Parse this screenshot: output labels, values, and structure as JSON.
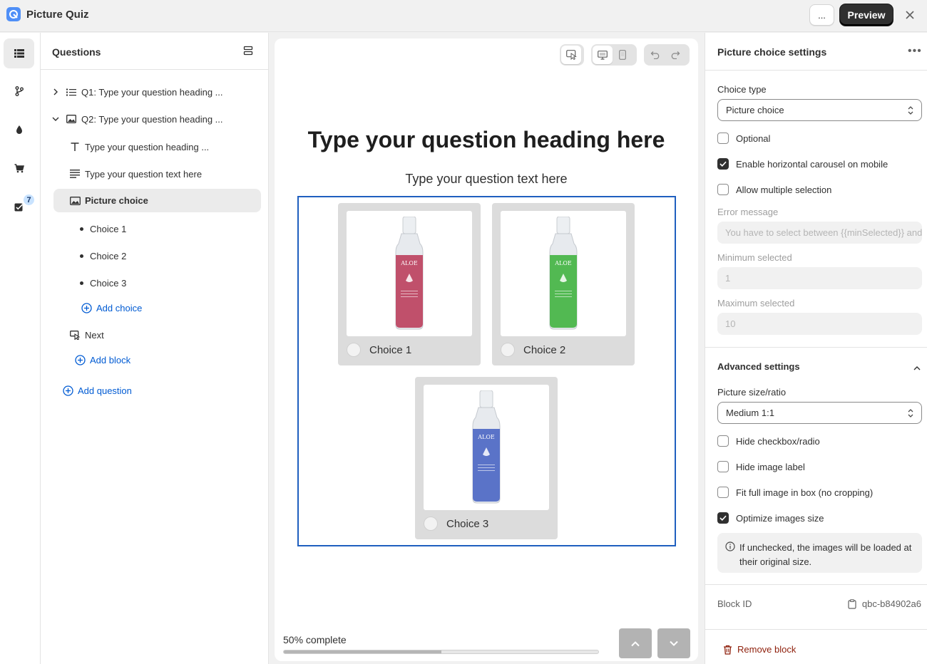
{
  "app": {
    "title": "Picture Quiz"
  },
  "topbar": {
    "more_label": "...",
    "preview_label": "Preview"
  },
  "rail": {
    "badge_count": "7"
  },
  "questions_panel": {
    "title": "Questions",
    "tree": [
      {
        "label": "Q1: Type your question heading ..."
      },
      {
        "label": "Q2: Type your question heading ..."
      },
      {
        "label": "Type your question heading ..."
      },
      {
        "label": "Type your question text here"
      },
      {
        "label": "Picture choice"
      },
      {
        "label": "Choice 1"
      },
      {
        "label": "Choice 2"
      },
      {
        "label": "Choice 3"
      },
      {
        "label": "Add choice"
      },
      {
        "label": "Next"
      },
      {
        "label": "Add block"
      },
      {
        "label": "Add question"
      }
    ]
  },
  "canvas": {
    "heading": "Type your question heading here",
    "text": "Type your question text here",
    "choices": [
      {
        "label": "Choice 1",
        "bottle_color": "#c0506b",
        "product_text": "ALOE"
      },
      {
        "label": "Choice 2",
        "bottle_color": "#52b952",
        "product_text": "ALOE"
      },
      {
        "label": "Choice 3",
        "bottle_color": "#5a73c8",
        "product_text": "ALOE"
      }
    ],
    "progress": {
      "label": "50% complete",
      "value": 0.5
    }
  },
  "settings": {
    "title": "Picture choice settings",
    "choice_type_label": "Choice type",
    "choice_type_value": "Picture choice",
    "optional_label": "Optional",
    "optional_checked": false,
    "carousel_label": "Enable horizontal carousel on mobile",
    "carousel_checked": true,
    "multiple_label": "Allow multiple selection",
    "multiple_checked": false,
    "error_message_label": "Error message",
    "error_message_value": "You have to select between {{minSelected}} and {{maxSelected}} choices",
    "min_selected_label": "Minimum selected",
    "min_selected_value": "1",
    "max_selected_label": "Maximum selected",
    "max_selected_value": "10",
    "advanced_title": "Advanced settings",
    "picture_size_label": "Picture size/ratio",
    "picture_size_value": "Medium 1:1",
    "hide_checkbox_label": "Hide checkbox/radio",
    "hide_checkbox_checked": false,
    "hide_image_label_label": "Hide image label",
    "hide_image_label_checked": false,
    "fit_full_image_label": "Fit full image in box (no cropping)",
    "fit_full_image_checked": false,
    "optimize_label": "Optimize images size",
    "optimize_checked": true,
    "info_text": "If unchecked, the images will be loaded at their original size.",
    "block_id_label": "Block ID",
    "block_id_value": "qbc-b84902a6",
    "remove_label": "Remove block"
  },
  "colors": {
    "accent": "#005bd3",
    "selection_border": "#1f5fbf",
    "danger": "#8e1f0b",
    "dark_button": "#303030"
  }
}
